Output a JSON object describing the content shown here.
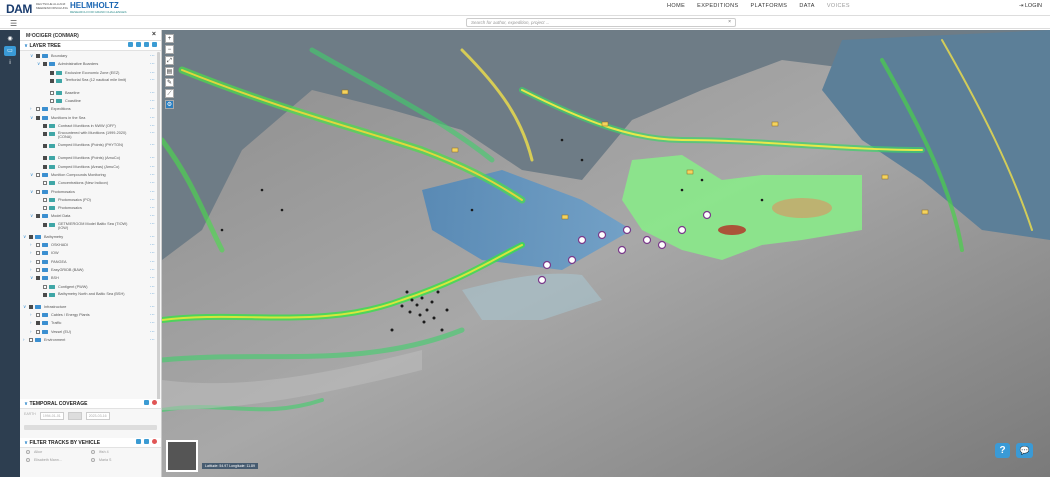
{
  "header": {
    "logo_dam": "DAM",
    "logo_dam_sub": "DEUTSCHE ALLIANZ MEERESFORSCHUNG",
    "logo_helmholtz": "HELMHOLTZ",
    "logo_helmholtz_sub": "RESEARCH FOR GRAND CHALLENGES",
    "nav": [
      "HOME",
      "EXPEDITIONS",
      "PLATFORMS",
      "DATA",
      "VOICES"
    ],
    "login": "LOGIN"
  },
  "search": {
    "placeholder": "Search for author, expedition, project ...",
    "clear": "×"
  },
  "panel": {
    "title": "M²OCIGER (CONMAR)",
    "close": "×",
    "layer_tree_title": "LAYER TREE",
    "tree": [
      {
        "label": "Boundary",
        "indent": 1,
        "chev": "v",
        "on": true
      },
      {
        "label": "Administrative Boarders",
        "indent": 2,
        "chev": "v",
        "on": true
      },
      {
        "label": "Exclusive Economic Zone (EEZ)",
        "indent": 3,
        "on": true
      },
      {
        "label": "Territorial Sea (12 nautical mile limit)",
        "indent": 3,
        "on": true,
        "tall": true
      },
      {
        "label": "Baseline",
        "indent": 3,
        "on": false
      },
      {
        "label": "Coastline",
        "indent": 3,
        "on": false
      },
      {
        "label": "Expeditions",
        "indent": 1,
        "chev": ">",
        "on": false
      },
      {
        "label": "Munitions in the Sea",
        "indent": 1,
        "chev": "v",
        "on": true
      },
      {
        "label": "Contract Munitions in NWW (OFF)",
        "indent": 2,
        "on": true
      },
      {
        "label": "Encountered with Munitions (1999-2020) (CONA)",
        "indent": 2,
        "on": true,
        "tall": true
      },
      {
        "label": "Dumped Munitions (Points) (PHYTON)",
        "indent": 2,
        "on": true,
        "tall": true
      },
      {
        "label": "Dumped Munitions (Points) (AmuCo)",
        "indent": 2,
        "on": true
      },
      {
        "label": "Dumped Munitions (Areas) (AmuCo)",
        "indent": 2,
        "on": true
      },
      {
        "label": "Munition Compounds Monitoring",
        "indent": 1,
        "chev": "v",
        "on": false
      },
      {
        "label": "Concentrations (New Indicon)",
        "indent": 2,
        "on": false
      },
      {
        "label": "Photomosaics",
        "indent": 1,
        "chev": "v",
        "on": false
      },
      {
        "label": "Photomosaics (PO)",
        "indent": 2,
        "on": false
      },
      {
        "label": "Photomosaics",
        "indent": 2,
        "on": false
      },
      {
        "label": "Model Data",
        "indent": 1,
        "chev": "v",
        "on": true
      },
      {
        "label": "GETM/ERGOM Model Baltic Sea (TIOW) (IOW)",
        "indent": 2,
        "on": true,
        "tall": true
      },
      {
        "label": "Bathymetry",
        "indent": 0,
        "chev": "v",
        "on": true
      },
      {
        "label": "OSKHADI",
        "indent": 1,
        "chev": ">",
        "on": false
      },
      {
        "label": "IOW",
        "indent": 1,
        "chev": ">",
        "on": false
      },
      {
        "label": "PANGEA",
        "indent": 1,
        "chev": ">",
        "on": false
      },
      {
        "label": "EasyGRIDB (BAW)",
        "indent": 1,
        "chev": ">",
        "on": false
      },
      {
        "label": "BSH",
        "indent": 1,
        "chev": "v",
        "on": true
      },
      {
        "label": "Contigent (PWW)",
        "indent": 2,
        "on": false
      },
      {
        "label": "Bathymetry North and Baltic Sea (BSH)",
        "indent": 2,
        "on": true,
        "tall": true
      },
      {
        "label": "Infrastructure",
        "indent": 0,
        "chev": "v",
        "on": true
      },
      {
        "label": "Cables / Energy Plants",
        "indent": 1,
        "chev": ">",
        "on": false
      },
      {
        "label": "Traffic",
        "indent": 1,
        "chev": ">",
        "on": true
      },
      {
        "label": "Vessel (EU)",
        "indent": 1,
        "chev": ">",
        "on": false
      },
      {
        "label": "Environment",
        "indent": 0,
        "chev": ">",
        "on": false
      }
    ],
    "temporal_title": "TEMPORAL COVERAGE",
    "temporal_labels": [
      "EARTH",
      "1994-01-01",
      "",
      "2023-03-16"
    ],
    "filter_title": "FILTER TRACKS BY VEHICLE",
    "filter_rows": [
      [
        "Alkor",
        "Ifish 4"
      ],
      [
        "Elisabeth Mann...",
        "Maria S"
      ]
    ]
  },
  "map": {
    "coords": "Latitude: 54.97  Longitude: 11.89",
    "help": "?",
    "chat": "💬"
  }
}
